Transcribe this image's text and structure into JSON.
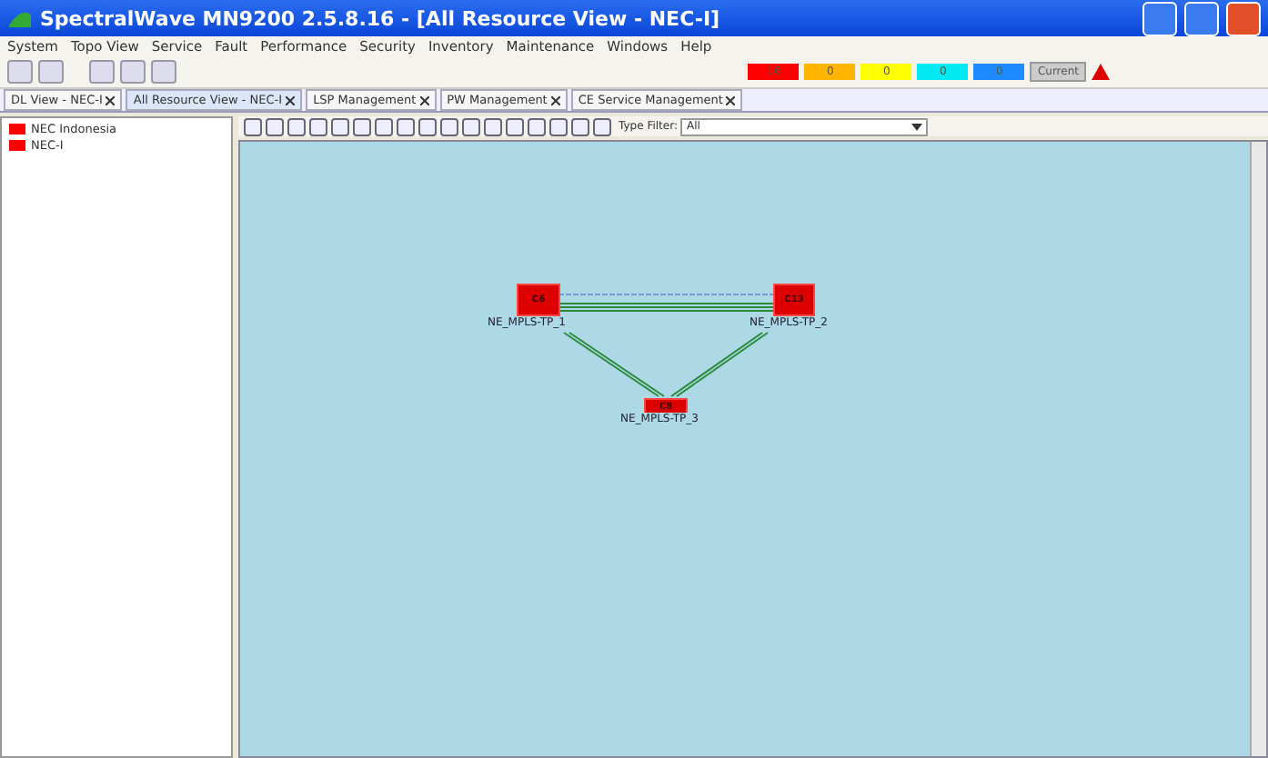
{
  "window": {
    "title": "SpectralWave MN9200 2.5.8.16 - [All Resource View - NEC-I]"
  },
  "menu": [
    "System",
    "Topo View",
    "Service",
    "Fault",
    "Performance",
    "Security",
    "Inventory",
    "Maintenance",
    "Windows",
    "Help"
  ],
  "alarms": [
    {
      "count": "16",
      "color": "#ff0000"
    },
    {
      "count": "0",
      "color": "#ffb400"
    },
    {
      "count": "0",
      "color": "#ffff00"
    },
    {
      "count": "0",
      "color": "#00e8f0"
    },
    {
      "count": "0",
      "color": "#1e8cff"
    }
  ],
  "alarm_mode": "Current",
  "tabs": [
    {
      "label": "DL View - NEC-I",
      "selected": false
    },
    {
      "label": "All Resource View - NEC-I",
      "selected": true
    },
    {
      "label": "LSP Management",
      "selected": false
    },
    {
      "label": "PW Management",
      "selected": false
    },
    {
      "label": "CE Service Management",
      "selected": false
    }
  ],
  "tree": [
    {
      "label": "NEC Indonesia"
    },
    {
      "label": "NEC-I"
    }
  ],
  "type_filter": {
    "label": "Type Filter:",
    "value": "All"
  },
  "nodes": [
    {
      "code": "C6",
      "name": "NE_MPLS-TP_1"
    },
    {
      "code": "C13",
      "name": "NE_MPLS-TP_2"
    },
    {
      "code": "C8",
      "name": "NE_MPLS-TP_3"
    }
  ]
}
